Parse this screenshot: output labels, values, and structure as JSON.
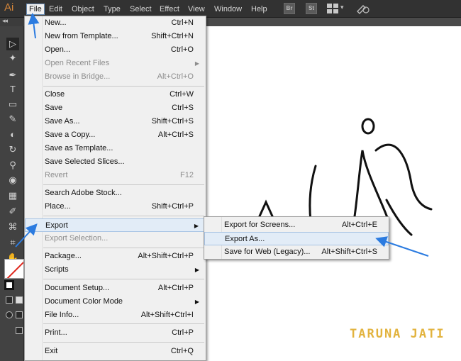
{
  "app": {
    "logo": "Ai"
  },
  "menubar": {
    "items": [
      "File",
      "Edit",
      "Object",
      "Type",
      "Select",
      "Effect",
      "View",
      "Window",
      "Help"
    ],
    "bridge_icon": "Br",
    "stock_icon": "St",
    "chevron": "▾"
  },
  "tabstrip": {
    "collapse": "◂◂"
  },
  "file_menu": {
    "items": [
      {
        "label": "New...",
        "shortcut": "Ctrl+N"
      },
      {
        "label": "New from Template...",
        "shortcut": "Shift+Ctrl+N"
      },
      {
        "label": "Open...",
        "shortcut": "Ctrl+O"
      },
      {
        "label": "Open Recent Files",
        "shortcut": ""
      },
      {
        "label": "Browse in Bridge...",
        "shortcut": "Alt+Ctrl+O"
      },
      {
        "label": "Close",
        "shortcut": "Ctrl+W"
      },
      {
        "label": "Save",
        "shortcut": "Ctrl+S"
      },
      {
        "label": "Save As...",
        "shortcut": "Shift+Ctrl+S"
      },
      {
        "label": "Save a Copy...",
        "shortcut": "Alt+Ctrl+S"
      },
      {
        "label": "Save as Template...",
        "shortcut": ""
      },
      {
        "label": "Save Selected Slices...",
        "shortcut": ""
      },
      {
        "label": "Revert",
        "shortcut": "F12"
      },
      {
        "label": "Search Adobe Stock...",
        "shortcut": ""
      },
      {
        "label": "Place...",
        "shortcut": "Shift+Ctrl+P"
      },
      {
        "label": "Export",
        "shortcut": ""
      },
      {
        "label": "Export Selection...",
        "shortcut": ""
      },
      {
        "label": "Package...",
        "shortcut": "Alt+Shift+Ctrl+P"
      },
      {
        "label": "Scripts",
        "shortcut": ""
      },
      {
        "label": "Document Setup...",
        "shortcut": "Alt+Ctrl+P"
      },
      {
        "label": "Document Color Mode",
        "shortcut": ""
      },
      {
        "label": "File Info...",
        "shortcut": "Alt+Shift+Ctrl+I"
      },
      {
        "label": "Print...",
        "shortcut": "Ctrl+P"
      },
      {
        "label": "Exit",
        "shortcut": "Ctrl+Q"
      }
    ],
    "submenu_arrow": "▶"
  },
  "export_submenu": {
    "items": [
      {
        "label": "Export for Screens...",
        "shortcut": "Alt+Ctrl+E"
      },
      {
        "label": "Export As...",
        "shortcut": ""
      },
      {
        "label": "Save for Web (Legacy)...",
        "shortcut": "Alt+Shift+Ctrl+S"
      }
    ]
  },
  "tools": {
    "icons": [
      "▷",
      "✦",
      "✒",
      "T",
      "▭",
      "✎",
      "◐",
      "↻",
      "⚲",
      "◉",
      "▦",
      "✐",
      "⌘",
      "⌗",
      "✋"
    ]
  },
  "watermark": "TARUNA JATI",
  "colors": {
    "annotation_arrow": "#2b7be0",
    "menu_highlight": "#e2ecf7",
    "watermark": "#e2b33e",
    "fill_none_slash": "#e0251b"
  }
}
